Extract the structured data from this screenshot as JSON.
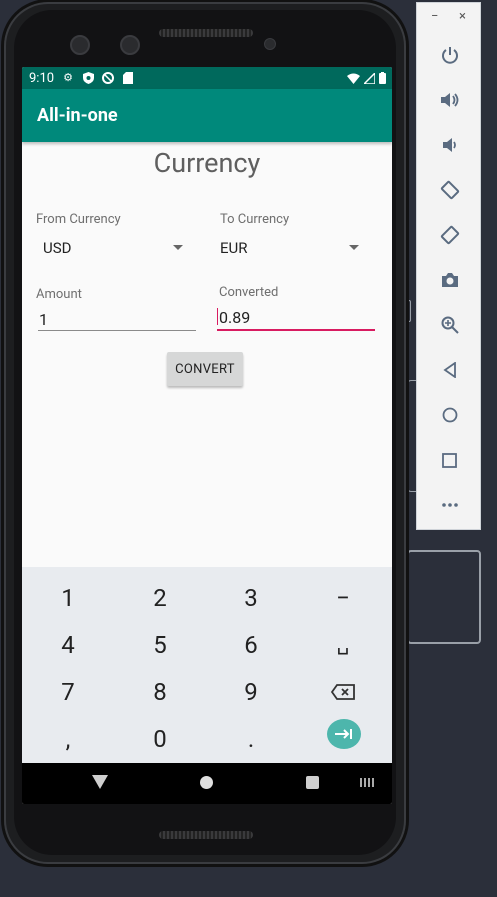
{
  "status_bar": {
    "time": "9:10"
  },
  "app_bar": {
    "title": "All-in-one"
  },
  "screen": {
    "title": "Currency",
    "from_label": "From Currency",
    "from_value": "USD",
    "to_label": "To Currency",
    "to_value": "EUR",
    "amount_label": "Amount",
    "amount_value": "1",
    "converted_label": "Converted",
    "converted_value": "0.89",
    "convert_button": "CONVERT"
  },
  "keyboard": {
    "row1": [
      "1",
      "2",
      "3",
      "−"
    ],
    "row2": [
      "4",
      "5",
      "6",
      "␣"
    ],
    "row3": [
      "7",
      "8",
      "9"
    ],
    "row4": [
      ",",
      "0",
      "."
    ]
  },
  "emulator_panel": {
    "minimize": "−",
    "close": "×",
    "buttons": [
      "power-icon",
      "volume-up-icon",
      "volume-down-icon",
      "rotate-left-icon",
      "rotate-right-icon",
      "camera-icon",
      "zoom-icon",
      "back-icon",
      "home-icon",
      "overview-icon",
      "more-icon"
    ]
  },
  "colors": {
    "status_bar": "#00695c",
    "app_bar": "#00897b",
    "accent": "#d81b60",
    "enter_key": "#4db6ac"
  }
}
